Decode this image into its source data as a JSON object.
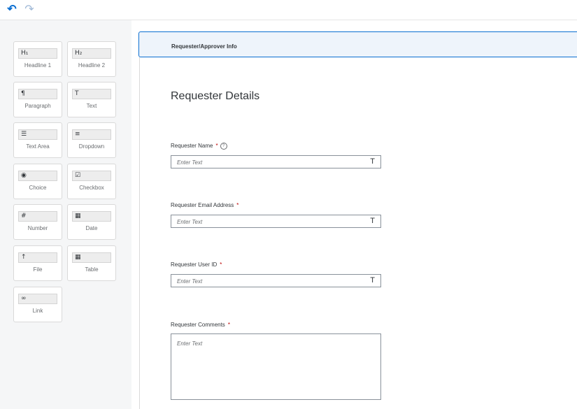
{
  "toolbar": {
    "undo_icon": "undo-icon",
    "redo_icon": "redo-icon"
  },
  "palette": {
    "items": [
      {
        "label": "Headline 1",
        "icon": "H₁",
        "icon_name": "headline1-icon"
      },
      {
        "label": "Headline 2",
        "icon": "H₂",
        "icon_name": "headline2-icon"
      },
      {
        "label": "Paragraph",
        "icon": "¶",
        "icon_name": "paragraph-icon"
      },
      {
        "label": "Text",
        "icon": "T",
        "icon_name": "text-icon"
      },
      {
        "label": "Text Area",
        "icon": "☰",
        "icon_name": "text-area-icon"
      },
      {
        "label": "Dropdown",
        "icon": "≡",
        "icon_name": "dropdown-icon"
      },
      {
        "label": "Choice",
        "icon": "◉",
        "icon_name": "choice-icon"
      },
      {
        "label": "Checkbox",
        "icon": "☑",
        "icon_name": "checkbox-icon"
      },
      {
        "label": "Number",
        "icon": "#",
        "icon_name": "number-icon"
      },
      {
        "label": "Date",
        "icon": "▦",
        "icon_name": "date-icon"
      },
      {
        "label": "File",
        "icon": "↑",
        "icon_name": "file-upload-icon"
      },
      {
        "label": "Table",
        "icon": "▦",
        "icon_name": "table-icon"
      },
      {
        "label": "Link",
        "icon": "∞",
        "icon_name": "link-icon"
      }
    ]
  },
  "section": {
    "title": "Requester/Approver Info"
  },
  "form": {
    "heading": "Requester Details",
    "fields": [
      {
        "label": "Requester Name",
        "required": "*",
        "placeholder": "Enter Text",
        "type_icon": "T",
        "help": "?"
      },
      {
        "label": "Requester Email Address",
        "required": "*",
        "placeholder": "Enter Text",
        "type_icon": "T"
      },
      {
        "label": "Requester User ID",
        "required": "*",
        "placeholder": "Enter Text",
        "type_icon": "T"
      },
      {
        "label": "Requester Comments",
        "required": "*",
        "placeholder": "Enter Text"
      }
    ]
  },
  "colors": {
    "accent": "#0a6ed1",
    "required": "#bb0000",
    "palette_bg": "#f5f6f7"
  }
}
